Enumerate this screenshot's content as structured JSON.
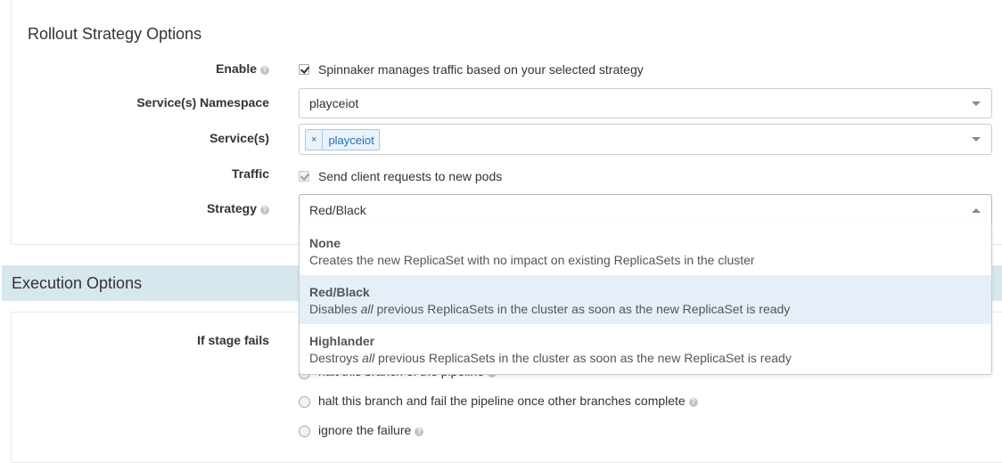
{
  "rollout": {
    "title": "Rollout Strategy Options",
    "enable": {
      "label": "Enable",
      "checked": true,
      "text": "Spinnaker manages traffic based on your selected strategy"
    },
    "namespace": {
      "label": "Service(s) Namespace",
      "value": "playceiot"
    },
    "services": {
      "label": "Service(s)",
      "tags": [
        "playceiot"
      ],
      "remove_glyph": "×"
    },
    "traffic": {
      "label": "Traffic",
      "checked": true,
      "text": "Send client requests to new pods"
    },
    "strategy": {
      "label": "Strategy",
      "value": "Red/Black",
      "options": [
        {
          "name": "None",
          "desc_before": "Creates the new ReplicaSet with no impact on existing ReplicaSets in the cluster",
          "desc_em": "",
          "desc_after": ""
        },
        {
          "name": "Red/Black",
          "desc_before": "Disables ",
          "desc_em": "all",
          "desc_after": " previous ReplicaSets in the cluster as soon as the new ReplicaSet is ready",
          "selected": true
        },
        {
          "name": "Highlander",
          "desc_before": "Destroys ",
          "desc_em": "all",
          "desc_after": " previous ReplicaSets in the cluster as soon as the new ReplicaSet is ready"
        }
      ]
    }
  },
  "execution": {
    "title": "Execution Options",
    "if_stage_fails_label": "If stage fails",
    "radio_options": [
      "halt this branch of the pipeline",
      "halt this branch and fail the pipeline once other branches complete",
      "ignore the failure"
    ]
  },
  "icons": {
    "help": "question-circle-icon",
    "checkmark": "check-icon",
    "dropdown": "caret-down-icon"
  },
  "colors": {
    "section_header_bg": "#d7e7ee",
    "selected_option_bg": "#e6eff8",
    "tag_text": "#1f6fb2"
  }
}
